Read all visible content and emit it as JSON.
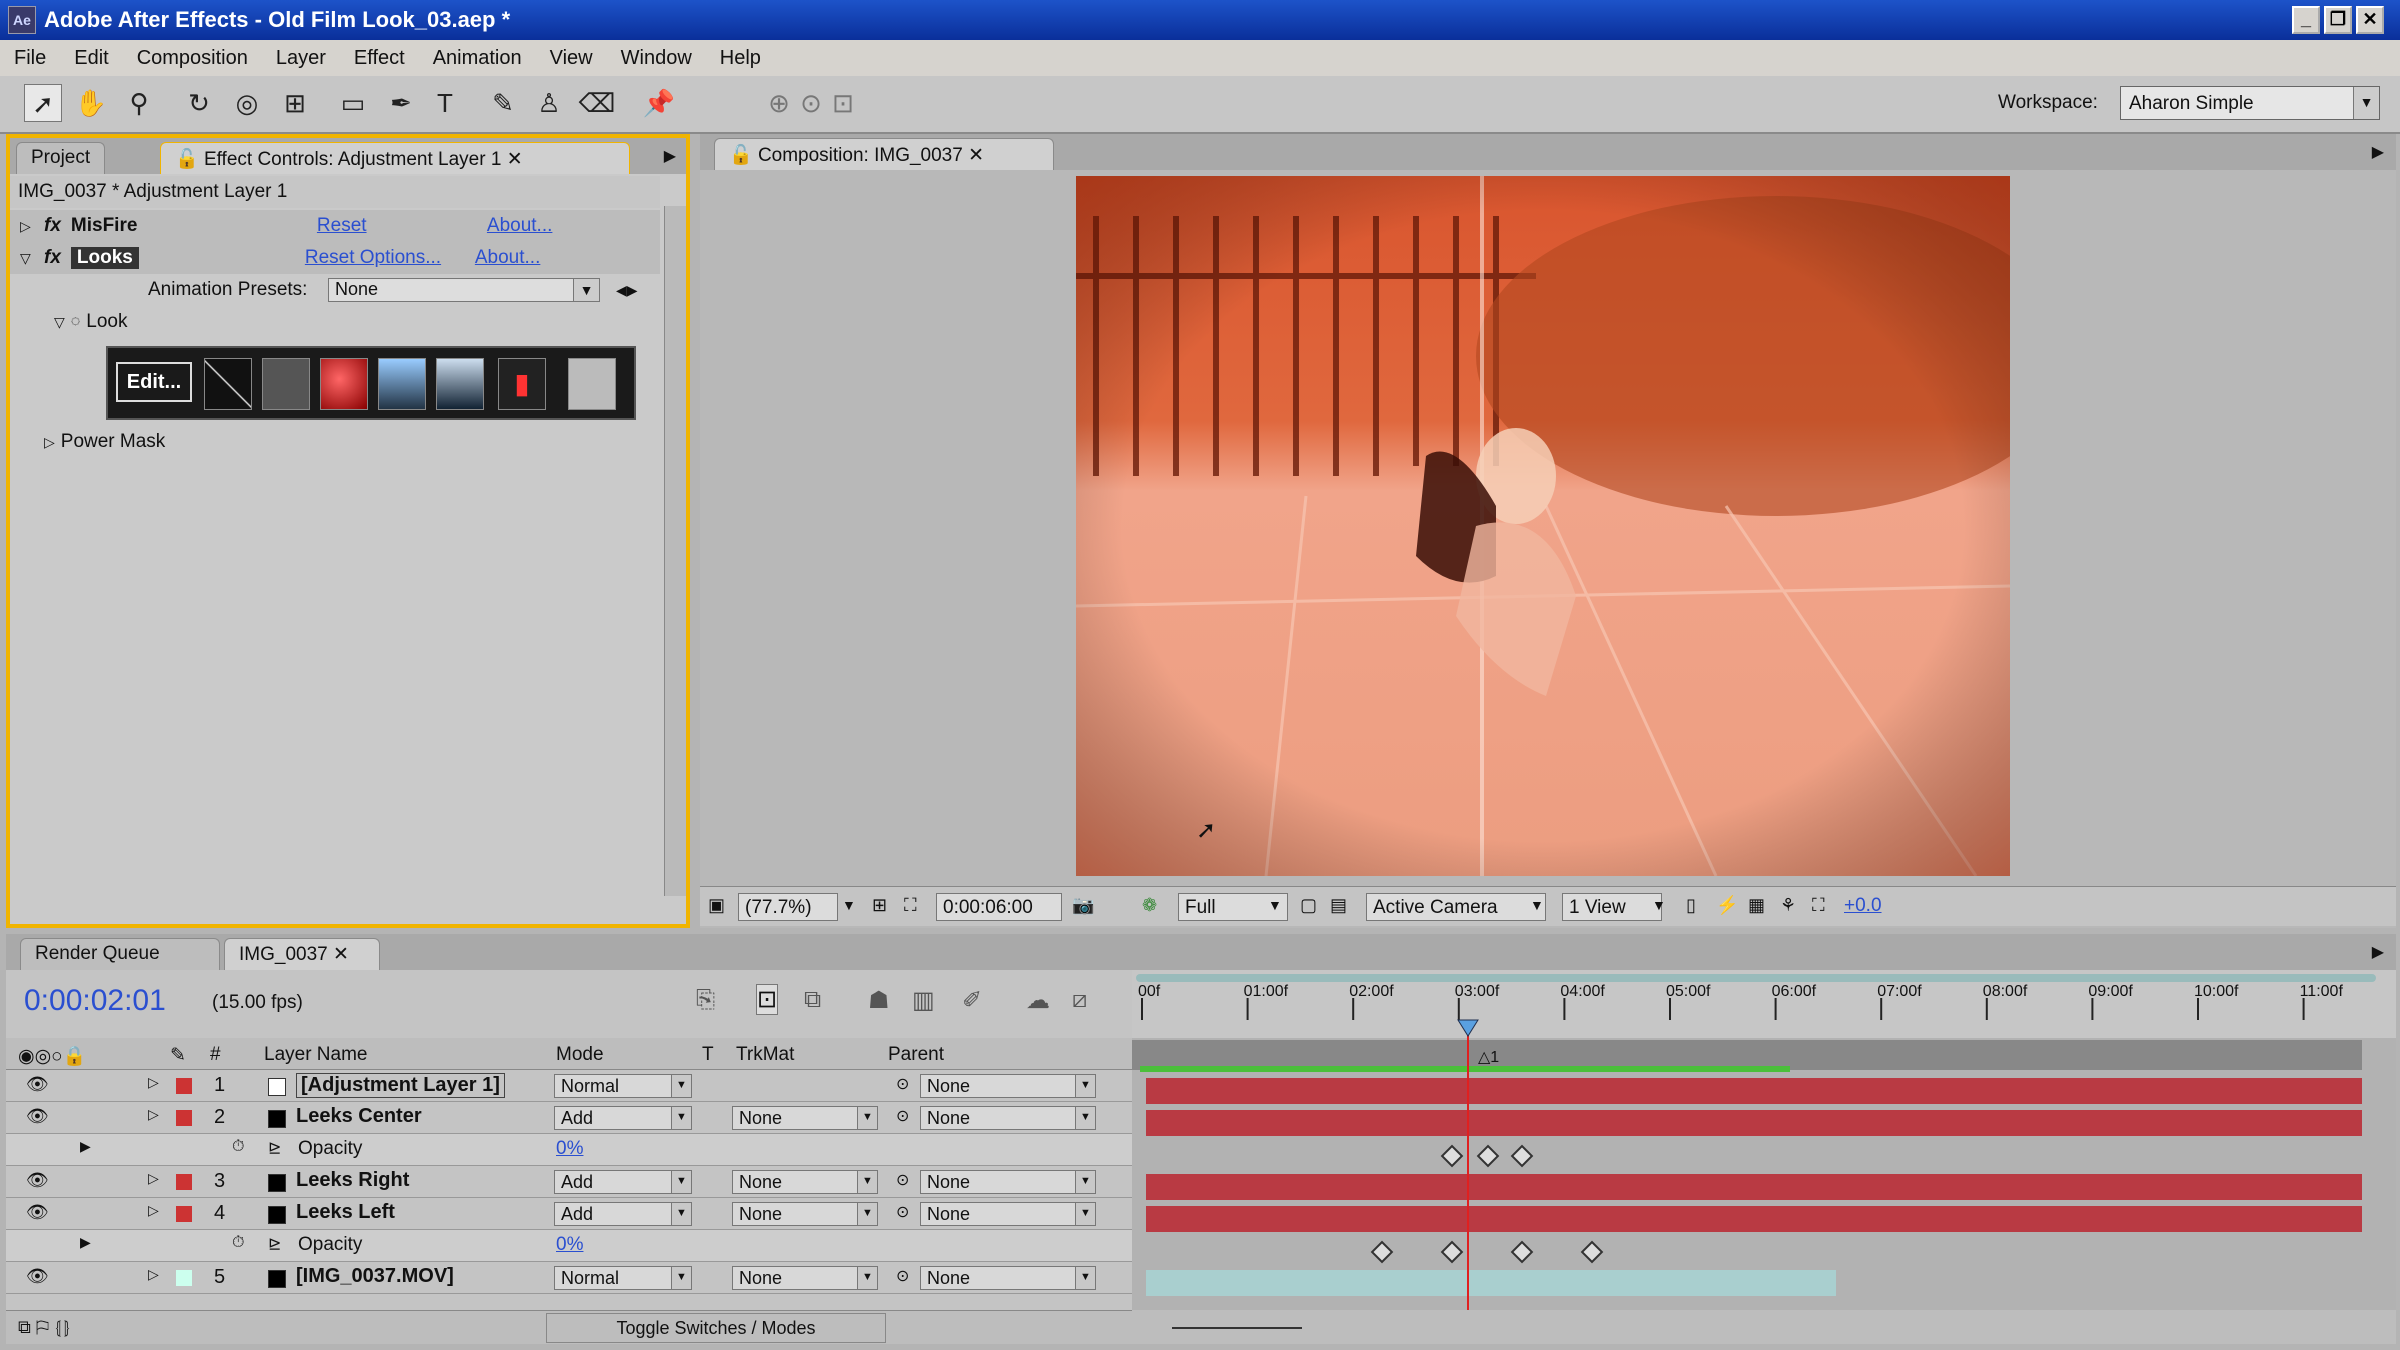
{
  "window": {
    "title": "Adobe After Effects - Old Film Look_03.aep *",
    "icon": "Ae"
  },
  "menu": [
    "File",
    "Edit",
    "Composition",
    "Layer",
    "Effect",
    "Animation",
    "View",
    "Window",
    "Help"
  ],
  "workspace": {
    "label": "Workspace:",
    "value": "Aharon Simple"
  },
  "project_panel": {
    "tab_project": "Project",
    "tab_effect_controls": "Effect Controls: Adjustment Layer 1",
    "header": "IMG_0037 * Adjustment Layer 1",
    "misfire": {
      "fx": "fx",
      "name": "MisFire",
      "reset": "Reset",
      "about": "About..."
    },
    "looks": {
      "fx": "fx",
      "name": "Looks",
      "reset": "Reset Options...",
      "about": "About..."
    },
    "presets": {
      "label": "Animation Presets:",
      "value": "None"
    },
    "look_label": "Look",
    "edit_button": "Edit...",
    "power_mask": "Power Mask"
  },
  "comp_panel": {
    "tab": "Composition: IMG_0037",
    "zoom": "(77.7%)",
    "timecode": "0:00:06:00",
    "resolution": "Full",
    "camera": "Active Camera",
    "views": "1 View",
    "exposure": "+0.0"
  },
  "timeline": {
    "tab_render": "Render Queue",
    "tab_comp": "IMG_0037",
    "current_time": "0:00:02:01",
    "fps": "(15.00 fps)",
    "headers": {
      "num": "#",
      "name": "Layer Name",
      "mode": "Mode",
      "t": "T",
      "trkmat": "TrkMat",
      "parent": "Parent"
    },
    "ruler": [
      "00f",
      "01:00f",
      "02:00f",
      "03:00f",
      "04:00f",
      "05:00f",
      "06:00f",
      "07:00f",
      "08:00f",
      "09:00f",
      "10:00f",
      "11:00f"
    ],
    "marker_label": "1",
    "layers": [
      {
        "num": "1",
        "name": "[Adjustment Layer 1]",
        "mode": "Normal",
        "trkmat": "",
        "parent": "None"
      },
      {
        "num": "2",
        "name": "Leeks Center",
        "mode": "Add",
        "trkmat": "None",
        "parent": "None"
      },
      {
        "num": "",
        "name": "Opacity",
        "mode": "0%",
        "trkmat": "",
        "parent": ""
      },
      {
        "num": "3",
        "name": "Leeks Right",
        "mode": "Add",
        "trkmat": "None",
        "parent": "None"
      },
      {
        "num": "4",
        "name": "Leeks Left",
        "mode": "Add",
        "trkmat": "None",
        "parent": "None"
      },
      {
        "num": "",
        "name": "Opacity",
        "mode": "0%",
        "trkmat": "",
        "parent": ""
      },
      {
        "num": "5",
        "name": "[IMG_0037.MOV]",
        "mode": "Normal",
        "trkmat": "None",
        "parent": "None"
      }
    ],
    "toggle_label": "Toggle Switches / Modes"
  },
  "colors": {
    "accent": "#f0b400",
    "layer_bar": "#b93a43",
    "timecode": "#2a4fd0",
    "title_bar": "#0a2f9a"
  }
}
